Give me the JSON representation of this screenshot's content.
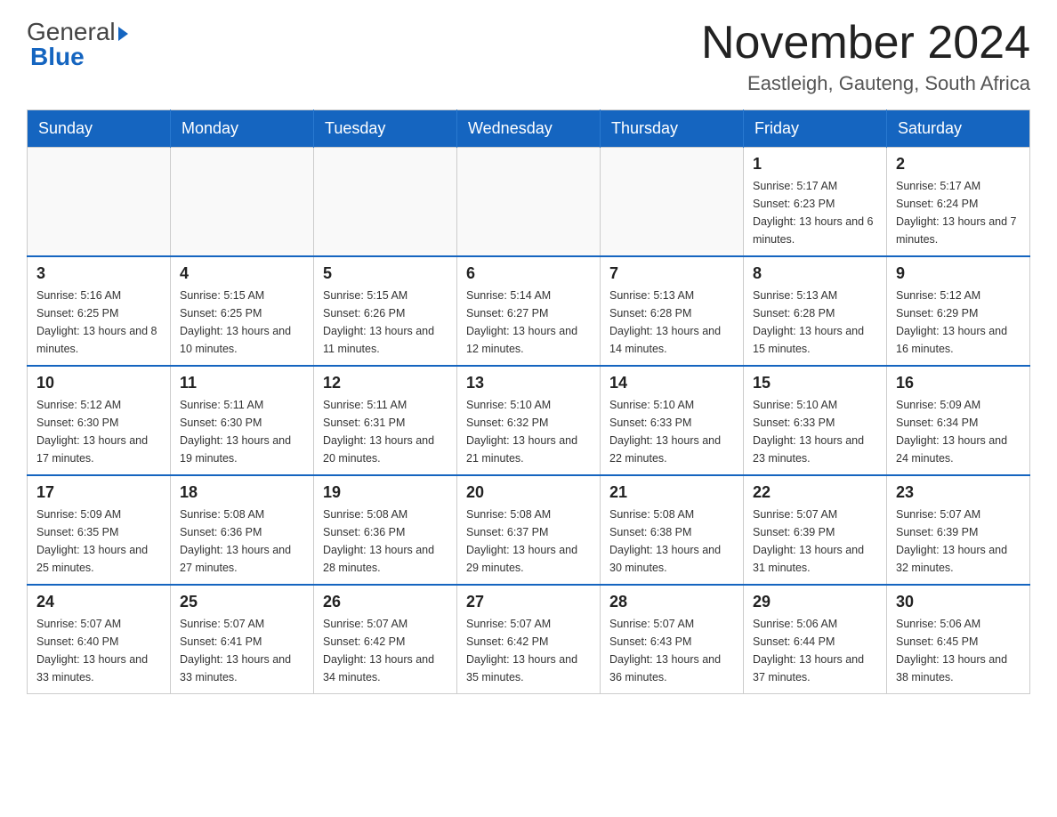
{
  "header": {
    "logo_general": "General",
    "logo_blue": "Blue",
    "title": "November 2024",
    "subtitle": "Eastleigh, Gauteng, South Africa"
  },
  "days_of_week": [
    "Sunday",
    "Monday",
    "Tuesday",
    "Wednesday",
    "Thursday",
    "Friday",
    "Saturday"
  ],
  "weeks": [
    {
      "days": [
        {
          "number": "",
          "info": ""
        },
        {
          "number": "",
          "info": ""
        },
        {
          "number": "",
          "info": ""
        },
        {
          "number": "",
          "info": ""
        },
        {
          "number": "",
          "info": ""
        },
        {
          "number": "1",
          "info": "Sunrise: 5:17 AM\nSunset: 6:23 PM\nDaylight: 13 hours and 6 minutes."
        },
        {
          "number": "2",
          "info": "Sunrise: 5:17 AM\nSunset: 6:24 PM\nDaylight: 13 hours and 7 minutes."
        }
      ]
    },
    {
      "days": [
        {
          "number": "3",
          "info": "Sunrise: 5:16 AM\nSunset: 6:25 PM\nDaylight: 13 hours and 8 minutes."
        },
        {
          "number": "4",
          "info": "Sunrise: 5:15 AM\nSunset: 6:25 PM\nDaylight: 13 hours and 10 minutes."
        },
        {
          "number": "5",
          "info": "Sunrise: 5:15 AM\nSunset: 6:26 PM\nDaylight: 13 hours and 11 minutes."
        },
        {
          "number": "6",
          "info": "Sunrise: 5:14 AM\nSunset: 6:27 PM\nDaylight: 13 hours and 12 minutes."
        },
        {
          "number": "7",
          "info": "Sunrise: 5:13 AM\nSunset: 6:28 PM\nDaylight: 13 hours and 14 minutes."
        },
        {
          "number": "8",
          "info": "Sunrise: 5:13 AM\nSunset: 6:28 PM\nDaylight: 13 hours and 15 minutes."
        },
        {
          "number": "9",
          "info": "Sunrise: 5:12 AM\nSunset: 6:29 PM\nDaylight: 13 hours and 16 minutes."
        }
      ]
    },
    {
      "days": [
        {
          "number": "10",
          "info": "Sunrise: 5:12 AM\nSunset: 6:30 PM\nDaylight: 13 hours and 17 minutes."
        },
        {
          "number": "11",
          "info": "Sunrise: 5:11 AM\nSunset: 6:30 PM\nDaylight: 13 hours and 19 minutes."
        },
        {
          "number": "12",
          "info": "Sunrise: 5:11 AM\nSunset: 6:31 PM\nDaylight: 13 hours and 20 minutes."
        },
        {
          "number": "13",
          "info": "Sunrise: 5:10 AM\nSunset: 6:32 PM\nDaylight: 13 hours and 21 minutes."
        },
        {
          "number": "14",
          "info": "Sunrise: 5:10 AM\nSunset: 6:33 PM\nDaylight: 13 hours and 22 minutes."
        },
        {
          "number": "15",
          "info": "Sunrise: 5:10 AM\nSunset: 6:33 PM\nDaylight: 13 hours and 23 minutes."
        },
        {
          "number": "16",
          "info": "Sunrise: 5:09 AM\nSunset: 6:34 PM\nDaylight: 13 hours and 24 minutes."
        }
      ]
    },
    {
      "days": [
        {
          "number": "17",
          "info": "Sunrise: 5:09 AM\nSunset: 6:35 PM\nDaylight: 13 hours and 25 minutes."
        },
        {
          "number": "18",
          "info": "Sunrise: 5:08 AM\nSunset: 6:36 PM\nDaylight: 13 hours and 27 minutes."
        },
        {
          "number": "19",
          "info": "Sunrise: 5:08 AM\nSunset: 6:36 PM\nDaylight: 13 hours and 28 minutes."
        },
        {
          "number": "20",
          "info": "Sunrise: 5:08 AM\nSunset: 6:37 PM\nDaylight: 13 hours and 29 minutes."
        },
        {
          "number": "21",
          "info": "Sunrise: 5:08 AM\nSunset: 6:38 PM\nDaylight: 13 hours and 30 minutes."
        },
        {
          "number": "22",
          "info": "Sunrise: 5:07 AM\nSunset: 6:39 PM\nDaylight: 13 hours and 31 minutes."
        },
        {
          "number": "23",
          "info": "Sunrise: 5:07 AM\nSunset: 6:39 PM\nDaylight: 13 hours and 32 minutes."
        }
      ]
    },
    {
      "days": [
        {
          "number": "24",
          "info": "Sunrise: 5:07 AM\nSunset: 6:40 PM\nDaylight: 13 hours and 33 minutes."
        },
        {
          "number": "25",
          "info": "Sunrise: 5:07 AM\nSunset: 6:41 PM\nDaylight: 13 hours and 33 minutes."
        },
        {
          "number": "26",
          "info": "Sunrise: 5:07 AM\nSunset: 6:42 PM\nDaylight: 13 hours and 34 minutes."
        },
        {
          "number": "27",
          "info": "Sunrise: 5:07 AM\nSunset: 6:42 PM\nDaylight: 13 hours and 35 minutes."
        },
        {
          "number": "28",
          "info": "Sunrise: 5:07 AM\nSunset: 6:43 PM\nDaylight: 13 hours and 36 minutes."
        },
        {
          "number": "29",
          "info": "Sunrise: 5:06 AM\nSunset: 6:44 PM\nDaylight: 13 hours and 37 minutes."
        },
        {
          "number": "30",
          "info": "Sunrise: 5:06 AM\nSunset: 6:45 PM\nDaylight: 13 hours and 38 minutes."
        }
      ]
    }
  ]
}
